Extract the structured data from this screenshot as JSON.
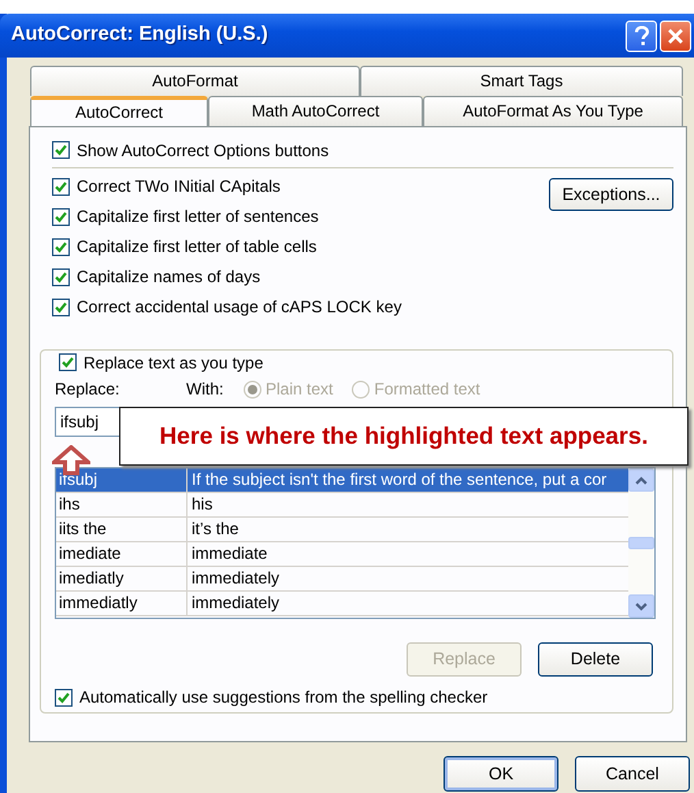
{
  "window": {
    "title": "AutoCorrect: English (U.S.)"
  },
  "tab_rows": [
    [
      {
        "label": "AutoFormat",
        "selected": false
      },
      {
        "label": "Smart Tags",
        "selected": false
      }
    ],
    [
      {
        "label": "AutoCorrect",
        "selected": true
      },
      {
        "label": "Math AutoCorrect",
        "selected": false
      },
      {
        "label": "AutoFormat As You Type",
        "selected": false
      }
    ]
  ],
  "show_options": {
    "label": "Show AutoCorrect Options buttons",
    "checked": true
  },
  "options": [
    {
      "label": "Correct TWo INitial CApitals",
      "checked": true
    },
    {
      "label": "Capitalize first letter of sentences",
      "checked": true
    },
    {
      "label": "Capitalize first letter of table cells",
      "checked": true
    },
    {
      "label": "Capitalize names of days",
      "checked": true
    },
    {
      "label": "Correct accidental usage of cAPS LOCK key",
      "checked": true
    }
  ],
  "exceptions_button": "Exceptions...",
  "replace_group": {
    "label": "Replace text as you type",
    "checked": true,
    "replace_label": "Replace:",
    "with_label": "With:",
    "format_options": [
      {
        "label": "Plain text",
        "selected": true,
        "disabled": true
      },
      {
        "label": "Formatted text",
        "selected": false,
        "disabled": true
      }
    ],
    "replace_value": "ifsubj",
    "rows": [
      {
        "replace": "ifsubj",
        "with": "If the subject isn't the first word of the sentence, put a cor",
        "selected": true
      },
      {
        "replace": "ihs",
        "with": "his",
        "selected": false
      },
      {
        "replace": "iits the",
        "with": "it’s the",
        "selected": false
      },
      {
        "replace": "imediate",
        "with": "immediate",
        "selected": false
      },
      {
        "replace": "imediatly",
        "with": "immediately",
        "selected": false
      },
      {
        "replace": "immediatly",
        "with": "immediately",
        "selected": false
      }
    ],
    "buttons": [
      {
        "label": "Replace",
        "disabled": true
      },
      {
        "label": "Delete",
        "disabled": false
      }
    ],
    "spelling": {
      "label": "Automatically use suggestions from the spelling checker",
      "checked": true
    }
  },
  "footer_buttons": [
    {
      "label": "OK",
      "default": true
    },
    {
      "label": "Cancel",
      "default": false
    }
  ],
  "callout": {
    "text": "Here is where the highlighted text appears."
  }
}
